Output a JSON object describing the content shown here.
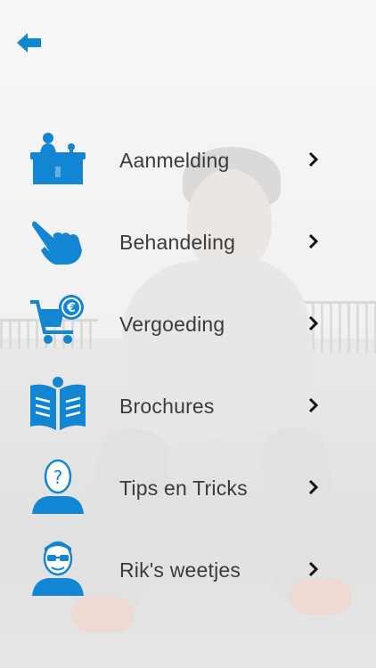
{
  "header": {
    "back_icon": "arrow-left-icon"
  },
  "colors": {
    "accent": "#1286d2",
    "text": "#3b3b3b"
  },
  "menu": {
    "items": [
      {
        "label": "Aanmelding",
        "icon": "reception-desk-icon"
      },
      {
        "label": "Behandeling",
        "icon": "pointing-hand-icon"
      },
      {
        "label": "Vergoeding",
        "icon": "shopping-cart-euro-icon"
      },
      {
        "label": "Brochures",
        "icon": "open-book-info-icon"
      },
      {
        "label": "Tips en Tricks",
        "icon": "person-question-icon"
      },
      {
        "label": "Rik's weetjes",
        "icon": "person-glasses-icon"
      }
    ]
  }
}
